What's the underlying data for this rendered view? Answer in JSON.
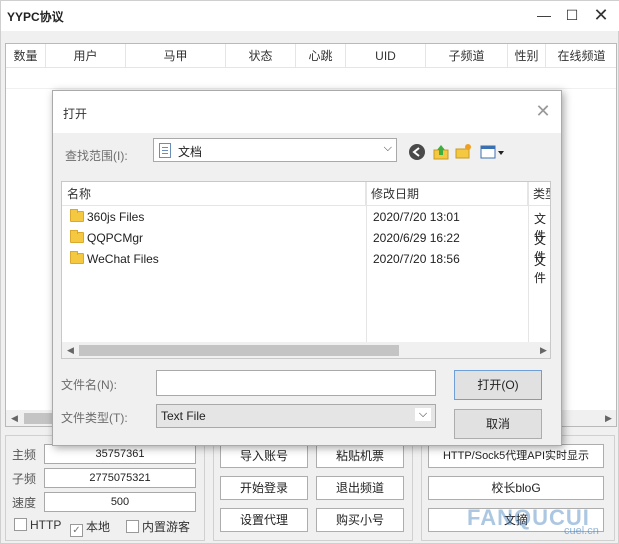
{
  "app": {
    "title": "YYPC协议",
    "minimize_glyph": "—",
    "maximize_glyph": "☐",
    "close_glyph": "✕"
  },
  "grid": {
    "columns": [
      "数量",
      "用户",
      "马甲",
      "状态",
      "心跳",
      "UID",
      "子频道",
      "性别",
      "在线频道"
    ]
  },
  "info_panel": {
    "main_channel_label": "主频",
    "main_channel_value": "35757361",
    "sub_channel_label": "子频",
    "sub_channel_value": "2775075321",
    "speed_label": "速度",
    "speed_value": "500",
    "http_label": "HTTP",
    "local_label": "本地",
    "guest_label": "内置游客",
    "local_checked": true
  },
  "actions": {
    "import_accounts": "导入账号",
    "paste_mic": "粘贴机票",
    "start_login": "开始登录",
    "exit_channel": "退出频道",
    "set_proxy": "设置代理",
    "buy_accounts": "购买小号"
  },
  "proxy_panel": {
    "http_sock5": "HTTP/Sock5代理API实时显示",
    "blog": "校长bloG",
    "third": "文摘"
  },
  "dialog": {
    "title": "打开",
    "close_glyph": "✕",
    "lookin_label": "查找范围(I):",
    "lookin_value": "文档",
    "columns": {
      "name": "名称",
      "modified": "修改日期",
      "type": "类型"
    },
    "files": [
      {
        "name": "360js Files",
        "modified": "2020/7/20 13:01",
        "type": "文件"
      },
      {
        "name": "QQPCMgr",
        "modified": "2020/6/29 16:22",
        "type": "文件"
      },
      {
        "name": "WeChat Files",
        "modified": "2020/7/20 18:56",
        "type": "文件"
      }
    ],
    "filename_label": "文件名(N):",
    "filename_value": "",
    "filetype_label": "文件类型(T):",
    "filetype_value": "Text File",
    "open_button": "打开(O)",
    "cancel_button": "取消"
  },
  "watermark": {
    "text": "FANQUCUI",
    "sub": "cuel.cn"
  }
}
